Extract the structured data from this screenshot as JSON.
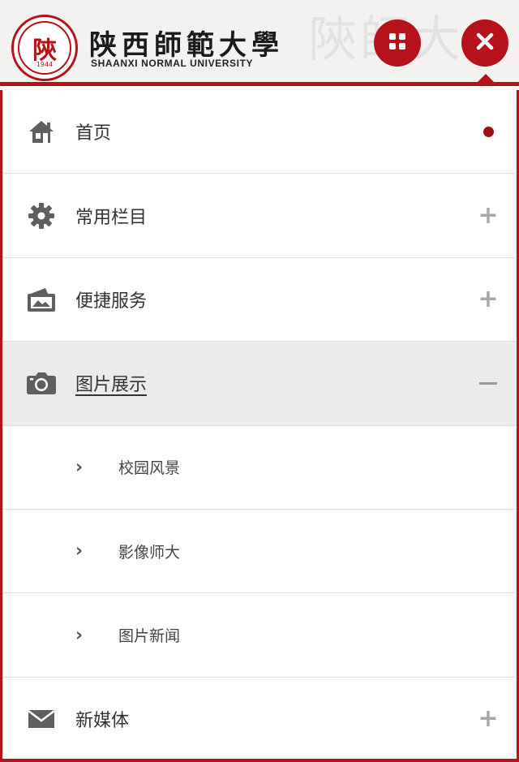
{
  "header": {
    "logo_cn": "陕西師範大學",
    "logo_en": "SHAANXI NORMAL UNIVERSITY",
    "seal_char": "陝",
    "seal_year": "1944",
    "watermark": "陝師大"
  },
  "icons": {
    "grid": "grid-icon",
    "close": "close-icon"
  },
  "menu": {
    "items": [
      {
        "label": "首页",
        "icon": "home-icon",
        "indicator": "dot"
      },
      {
        "label": "常用栏目",
        "icon": "gear-icon",
        "indicator": "plus"
      },
      {
        "label": "便捷服务",
        "icon": "wallet-icon",
        "indicator": "plus"
      },
      {
        "label": "图片展示",
        "icon": "camera-icon",
        "indicator": "minus",
        "active": true
      },
      {
        "label": "新媒体",
        "icon": "mail-icon",
        "indicator": "plus"
      }
    ],
    "subitems": [
      {
        "label": "校园风景"
      },
      {
        "label": "影像师大"
      },
      {
        "label": "图片新闻"
      }
    ],
    "accent_color": "#b5121b"
  }
}
